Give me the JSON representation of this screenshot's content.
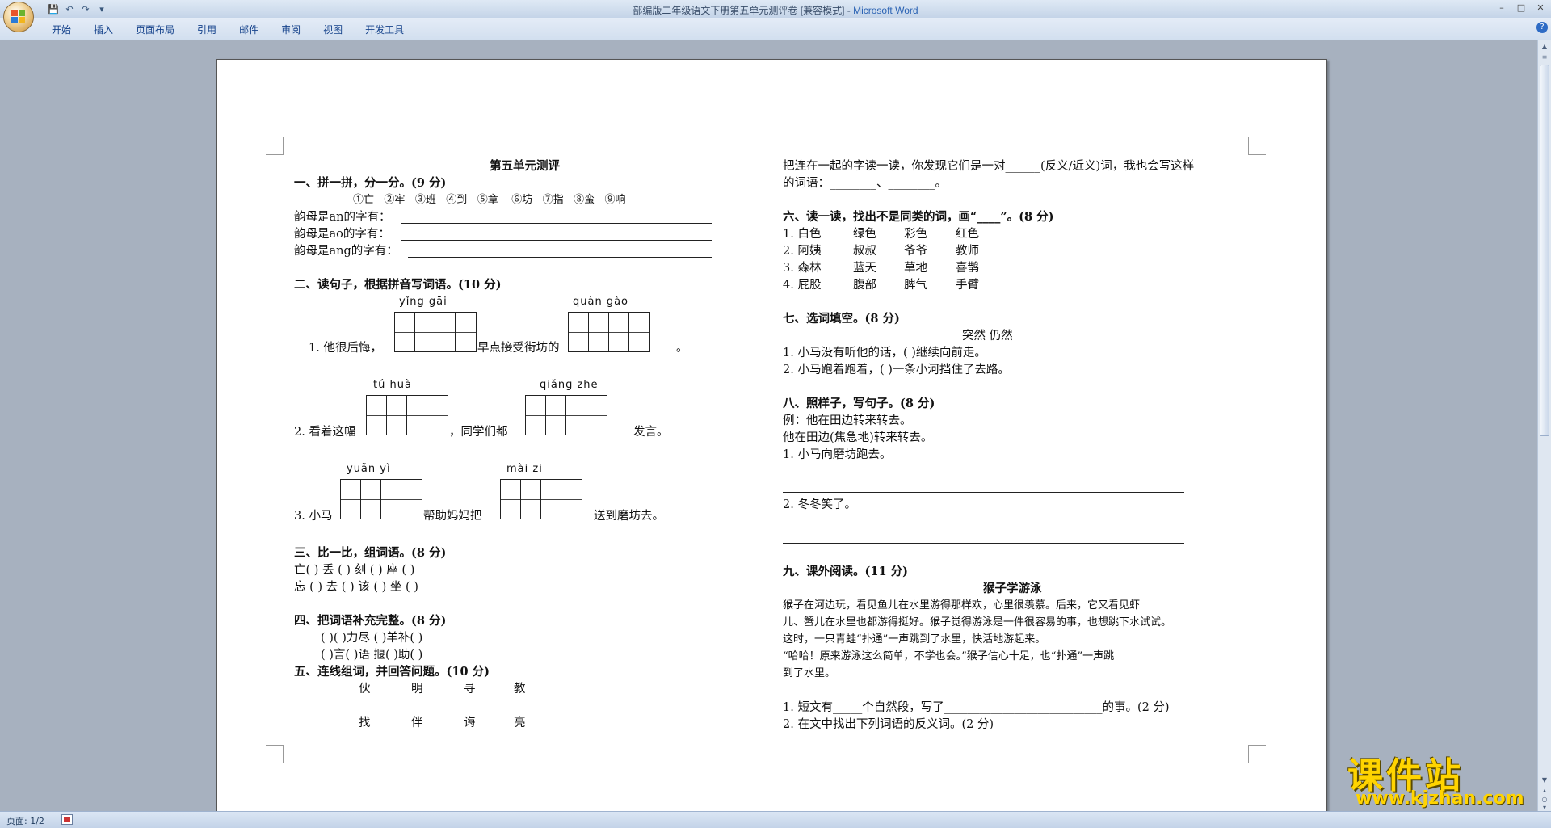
{
  "window": {
    "title": "部编版二年级语文下册第五单元测评卷 [兼容模式] - ",
    "app": "Microsoft Word"
  },
  "qat": {
    "save": "💾",
    "undo": "↶",
    "redo": "↷",
    "more": "▾"
  },
  "winctl": {
    "min": "–",
    "max": "□",
    "close": "✕"
  },
  "help": "?",
  "tabs": [
    "开始",
    "插入",
    "页面布局",
    "引用",
    "邮件",
    "审阅",
    "视图",
    "开发工具"
  ],
  "status": {
    "page": "页面: 1/2"
  },
  "watermark": {
    "main": "课件站",
    "url": "www.kjzhan.com"
  },
  "doc": {
    "title": "第五单元测评",
    "s1": {
      "head": "一、拼一拼，分一分。(9 分)",
      "items": [
        "①亡",
        "②牢",
        "③班",
        "④到",
        "⑤章",
        "⑥坊",
        "⑦指",
        "⑧蛮",
        "⑨响"
      ],
      "r1": "韵母是an的字有：",
      "r2": "韵母是ao的字有：",
      "r3": "韵母是ang的字有："
    },
    "s2": {
      "head": "二、读句子，根据拼音写词语。(10 分)",
      "q1": {
        "p1": "yǐng  gāi",
        "p2": "quàn   gào",
        "a": "1. 他很后悔，",
        "b": "早点接受街坊的",
        "c": "。"
      },
      "q2": {
        "p1": "tú   huà",
        "p2": "qiǎng  zhe",
        "a": "2. 看着这幅",
        "b": "，同学们都",
        "c": "发言。"
      },
      "q3": {
        "p1": "yuǎn   yì",
        "p2": "mài   zi",
        "a": "3. 小马",
        "b": "帮助妈妈把",
        "c": "送到磨坊去。"
      }
    },
    "s3": {
      "head": "三、比一比，组词语。(8 分)",
      "r1": "亡(         ) 丢 (         )  刻 (         )   座 (          )",
      "r2": "忘 (        )  去 (         )  该 (         )   坐 (          )"
    },
    "s4": {
      "head": "四、把词语补充完整。(8 分)",
      "r1": "(       )(        )力尽                (         )羊补(          )",
      "r2": "(       )言(        )语               揠(          )助(        )"
    },
    "s5": {
      "head": "五、连线组词，并回答问题。(10 分)",
      "r1": [
        "伙",
        "明",
        "寻",
        "教"
      ],
      "r2": [
        "找",
        "伴",
        "诲",
        "亮"
      ]
    },
    "r_intro1": "把连在一起的字读一读，你发现它们是一对______(反义/近义)词，我也会写这样",
    "r_intro2": "的词语：________、________。",
    "s6": {
      "head": "六、读一读，找出不是同类的词，画“____”。(8 分)",
      "rows": [
        [
          "1. 白色",
          "绿色",
          "彩色",
          "红色"
        ],
        [
          "2. 阿姨",
          "叔叔",
          "爷爷",
          "教师"
        ],
        [
          "3. 森林",
          "蓝天",
          "草地",
          "喜鹊"
        ],
        [
          "4. 屁股",
          "腹部",
          "脾气",
          "手臂"
        ]
      ]
    },
    "s7": {
      "head": "七、选词填空。(8 分)",
      "words": "突然           仍然",
      "q1": "1. 小马没有听他的话，(          )继续向前走。",
      "q2": "2. 小马跑着跑着，(          )一条小河挡住了去路。"
    },
    "s8": {
      "head": "八、照样子，写句子。(8 分)",
      "ex1": "例：他在田边转来转去。",
      "ex2": "他在田边(焦急地)转来转去。",
      "q1": "1. 小马向磨坊跑去。",
      "q2": "2. 冬冬笑了。"
    },
    "s9": {
      "head": "九、课外阅读。(11 分)",
      "title": "猴子学游泳",
      "p1": "    猴子在河边玩，看见鱼儿在水里游得那样欢，心里很羡慕。后来，它又看见虾",
      "p2": "儿、蟹儿在水里也都游得挺好。猴子觉得游泳是一件很容易的事，也想跳下水试试。",
      "p3": "    这时，一只青蛙“扑通”一声跳到了水里，快活地游起来。",
      "p4": "    “哈哈！原来游泳这么简单，不学也会。”猴子信心十足，也“扑通”一声跳",
      "p5": "到了水里。",
      "q1": "1. 短文有_____个自然段，写了___________________________的事。(2 分)",
      "q2": "2. 在文中找出下列词语的反义词。(2 分)"
    }
  }
}
